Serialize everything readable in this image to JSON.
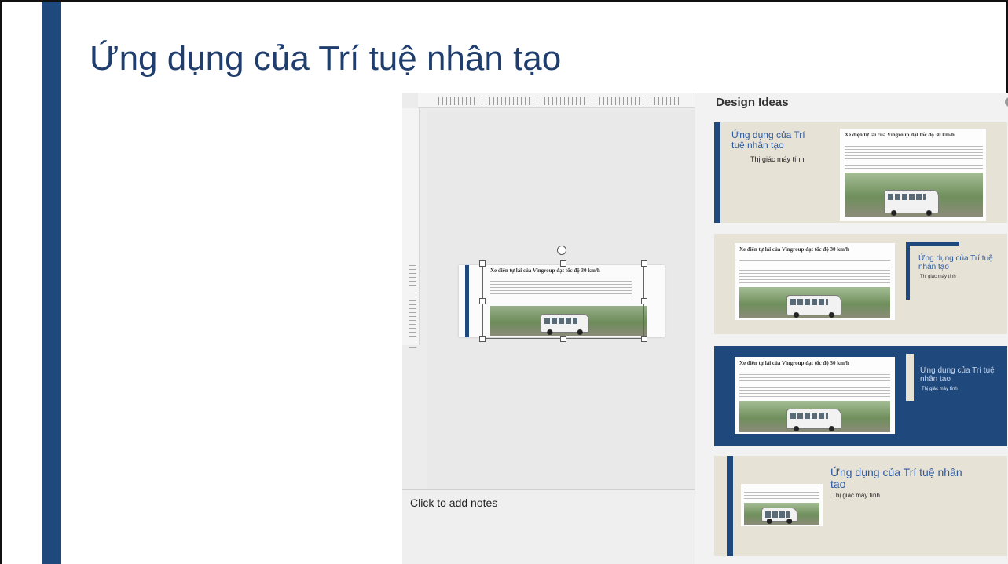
{
  "slide": {
    "title": "Ứng dụng của Trí tuệ nhân tạo",
    "accent_color": "#1f497d"
  },
  "editor": {
    "notes_placeholder": "Click to add notes",
    "mini_slide_title": "Xe điện tự lái của Vingroup đạt tốc độ 30 km/h",
    "rotate_icon": "rotate-handle-icon"
  },
  "designer": {
    "title": "Design Ideas",
    "ideas": [
      {
        "title": "Ứng dụng của Trí tuệ nhân tạo",
        "bullet": "Thị giác máy tính",
        "doc_title": "Xe điện tự lái của Vingroup đạt tốc độ 30 km/h"
      },
      {
        "title": "Ứng dụng của Trí tuệ nhân tạo",
        "bullet": "Thị giác máy tính",
        "doc_title": "Xe điện tự lái của Vingroup đạt tốc độ 30 km/h"
      },
      {
        "title": "Ứng dụng của Trí tuệ nhân tạo",
        "bullet": "Thị giác máy tính",
        "doc_title": "Xe điện tự lái của Vingroup đạt tốc độ 30 km/h"
      },
      {
        "title": "Ứng dụng của Trí tuệ nhân tạo",
        "bullet": "Thị giác máy tính"
      }
    ]
  }
}
